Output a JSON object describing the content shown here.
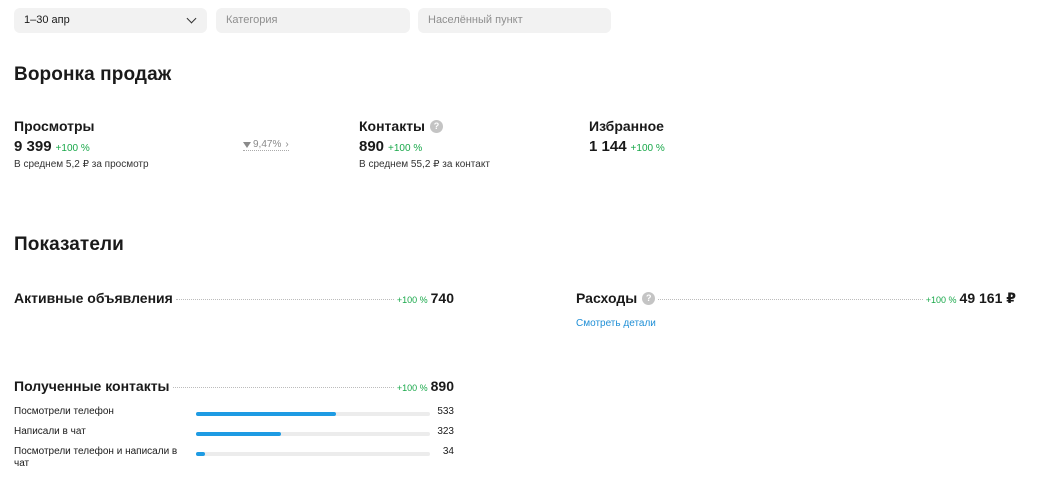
{
  "filters": {
    "date": "1–30 апр",
    "category_placeholder": "Категория",
    "city_placeholder": "Населённый пункт"
  },
  "funnel": {
    "title": "Воронка продаж",
    "views": {
      "label": "Просмотры",
      "value": "9 399",
      "delta": "+100 %",
      "sub": "В среднем 5,2 ₽ за просмотр"
    },
    "conversion": {
      "value": "9,47%",
      "arrow": "›"
    },
    "contacts": {
      "label": "Контакты",
      "value": "890",
      "delta": "+100 %",
      "sub": "В среднем 55,2 ₽ за контакт",
      "help": "?"
    },
    "favorites": {
      "label": "Избранное",
      "value": "1 144",
      "delta": "+100 %"
    }
  },
  "metrics": {
    "title": "Показатели",
    "active_ads": {
      "label": "Активные объявления",
      "delta": "+100 %",
      "value": "740"
    },
    "costs": {
      "label": "Расходы",
      "delta": "+100 %",
      "value": "49 161 ₽",
      "help": "?",
      "details_link": "Смотреть детали"
    },
    "received_contacts": {
      "label": "Полученные контакты",
      "delta": "+100 %",
      "value": "890",
      "breakdown": [
        {
          "label": "Посмотрели телефон",
          "value": "533",
          "fraction": 0.599
        },
        {
          "label": "Написали в чат",
          "value": "323",
          "fraction": 0.363
        },
        {
          "label": "Посмотрели телефон и написали в чат",
          "value": "34",
          "fraction": 0.038
        }
      ]
    }
  },
  "colors": {
    "accent": "#1e9be3",
    "positive": "#19a84a",
    "link": "#1f8fd6"
  },
  "icons": {
    "date_dropdown": "chevron-down-icon",
    "conversion": "funnel-icon",
    "help": "help-icon"
  }
}
